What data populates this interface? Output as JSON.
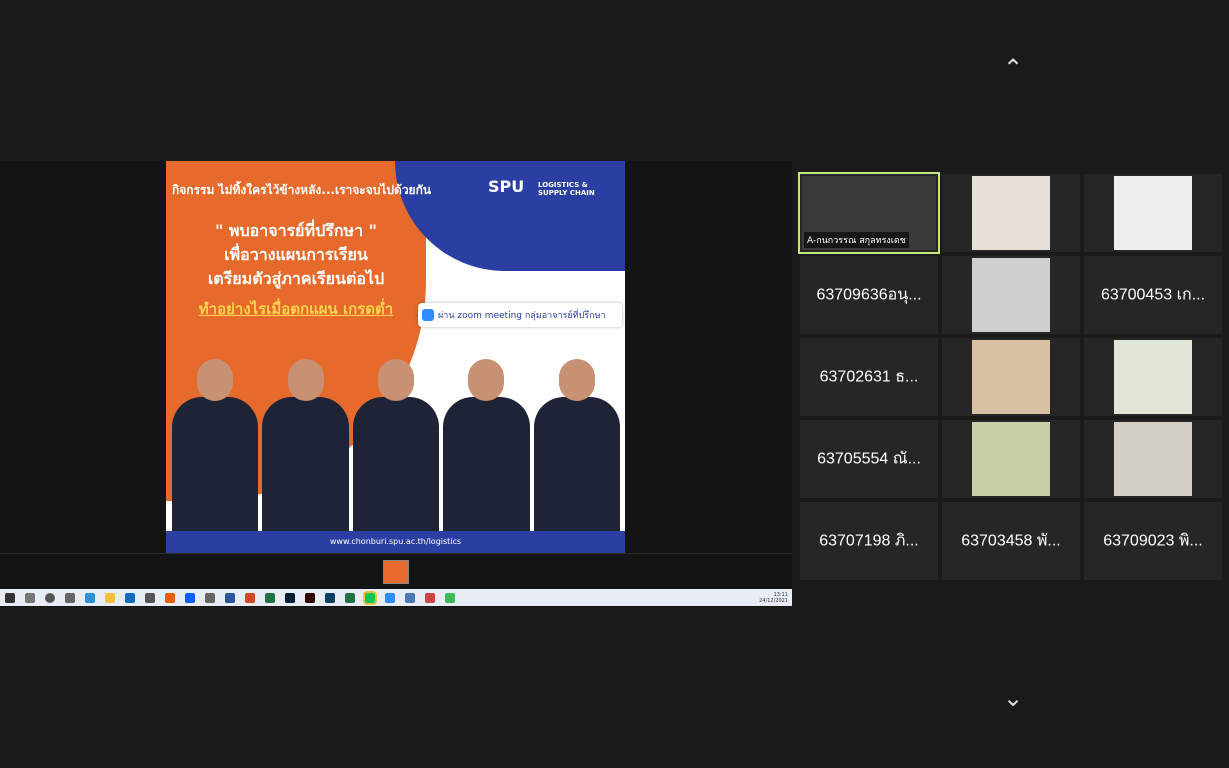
{
  "slide": {
    "header": "กิจกรรม ไม่ทิ้งใครไว้ข้างหลัง...เราจะจบไปด้วยกัน",
    "logo_spu": "SPU",
    "logo_logistics": "LOGISTICS & SUPPLY CHAIN",
    "line1": "\" พบอาจารย์ที่ปรึกษา \"",
    "line2": "เพื่อวางแผนการเรียน",
    "line3": "เตรียมตัวสู่ภาคเรียนต่อไป",
    "line4": "ทำอย่างไรเมื่อตกแผน เกรดต่ำ",
    "zoom_text": "ผ่าน zoom meeting กลุ่มอาจารย์ที่ปรึกษา",
    "footer": "www.chonburi.spu.ac.th/logistics"
  },
  "taskbar": {
    "time": "13:11",
    "date": "24/12/2021"
  },
  "participants": [
    {
      "name": "A-กนกวรรณ สกุลทรงเดช",
      "type": "video",
      "active": true
    },
    {
      "name": "",
      "type": "video"
    },
    {
      "name": "",
      "type": "video"
    },
    {
      "name": "63709636อนุ...",
      "type": "name"
    },
    {
      "name": "",
      "type": "video"
    },
    {
      "name": "63700453 เก...",
      "type": "name"
    },
    {
      "name": "63702631 ธ...",
      "type": "name"
    },
    {
      "name": "",
      "type": "video"
    },
    {
      "name": "",
      "type": "video"
    },
    {
      "name": "63705554 ณั...",
      "type": "name"
    },
    {
      "name": "",
      "type": "video"
    },
    {
      "name": "",
      "type": "video"
    },
    {
      "name": "63707198 ภิ...",
      "type": "name"
    },
    {
      "name": "63703458 พั...",
      "type": "name"
    },
    {
      "name": "63709023 พิ...",
      "type": "name"
    }
  ],
  "nav": {
    "up": "⌃",
    "down": "⌄"
  },
  "colors": {
    "active_outline": "#c6e87a",
    "tile_bg": "#262626",
    "slide_orange": "#e56a2b",
    "slide_blue": "#2b3fa3"
  }
}
